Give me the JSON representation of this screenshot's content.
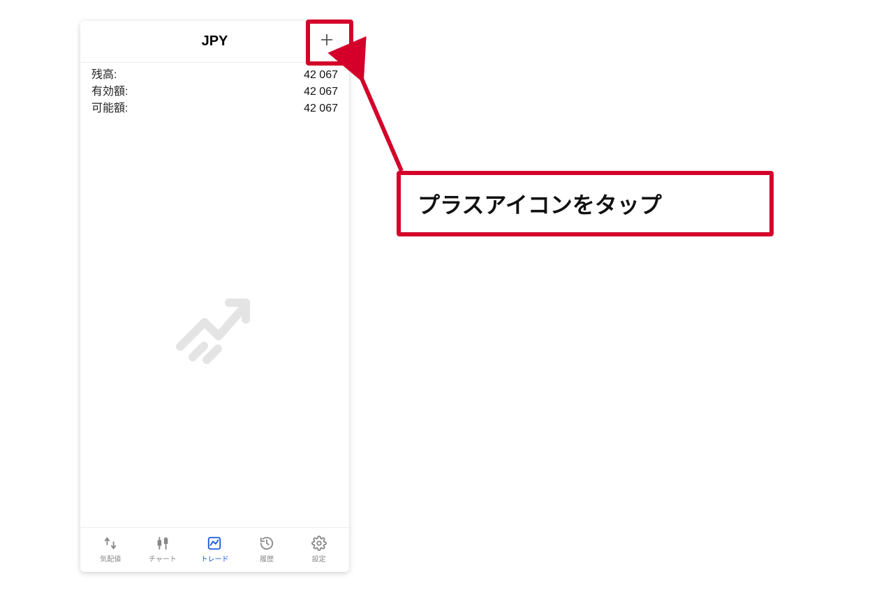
{
  "header": {
    "title": "JPY"
  },
  "balance": {
    "rows": [
      {
        "label": "残高:",
        "value": "42 067"
      },
      {
        "label": "有効額:",
        "value": "42 067"
      },
      {
        "label": "可能額:",
        "value": "42 067"
      }
    ]
  },
  "tabs": {
    "items": [
      {
        "label": "気配値",
        "icon": "quotes"
      },
      {
        "label": "チャート",
        "icon": "chart"
      },
      {
        "label": "トレード",
        "icon": "trade"
      },
      {
        "label": "履歴",
        "icon": "history"
      },
      {
        "label": "設定",
        "icon": "settings"
      }
    ],
    "active_index": 2
  },
  "callout": {
    "text": "プラスアイコンをタップ"
  },
  "colors": {
    "highlight": "#d4002a",
    "active_tab": "#1a56db"
  }
}
